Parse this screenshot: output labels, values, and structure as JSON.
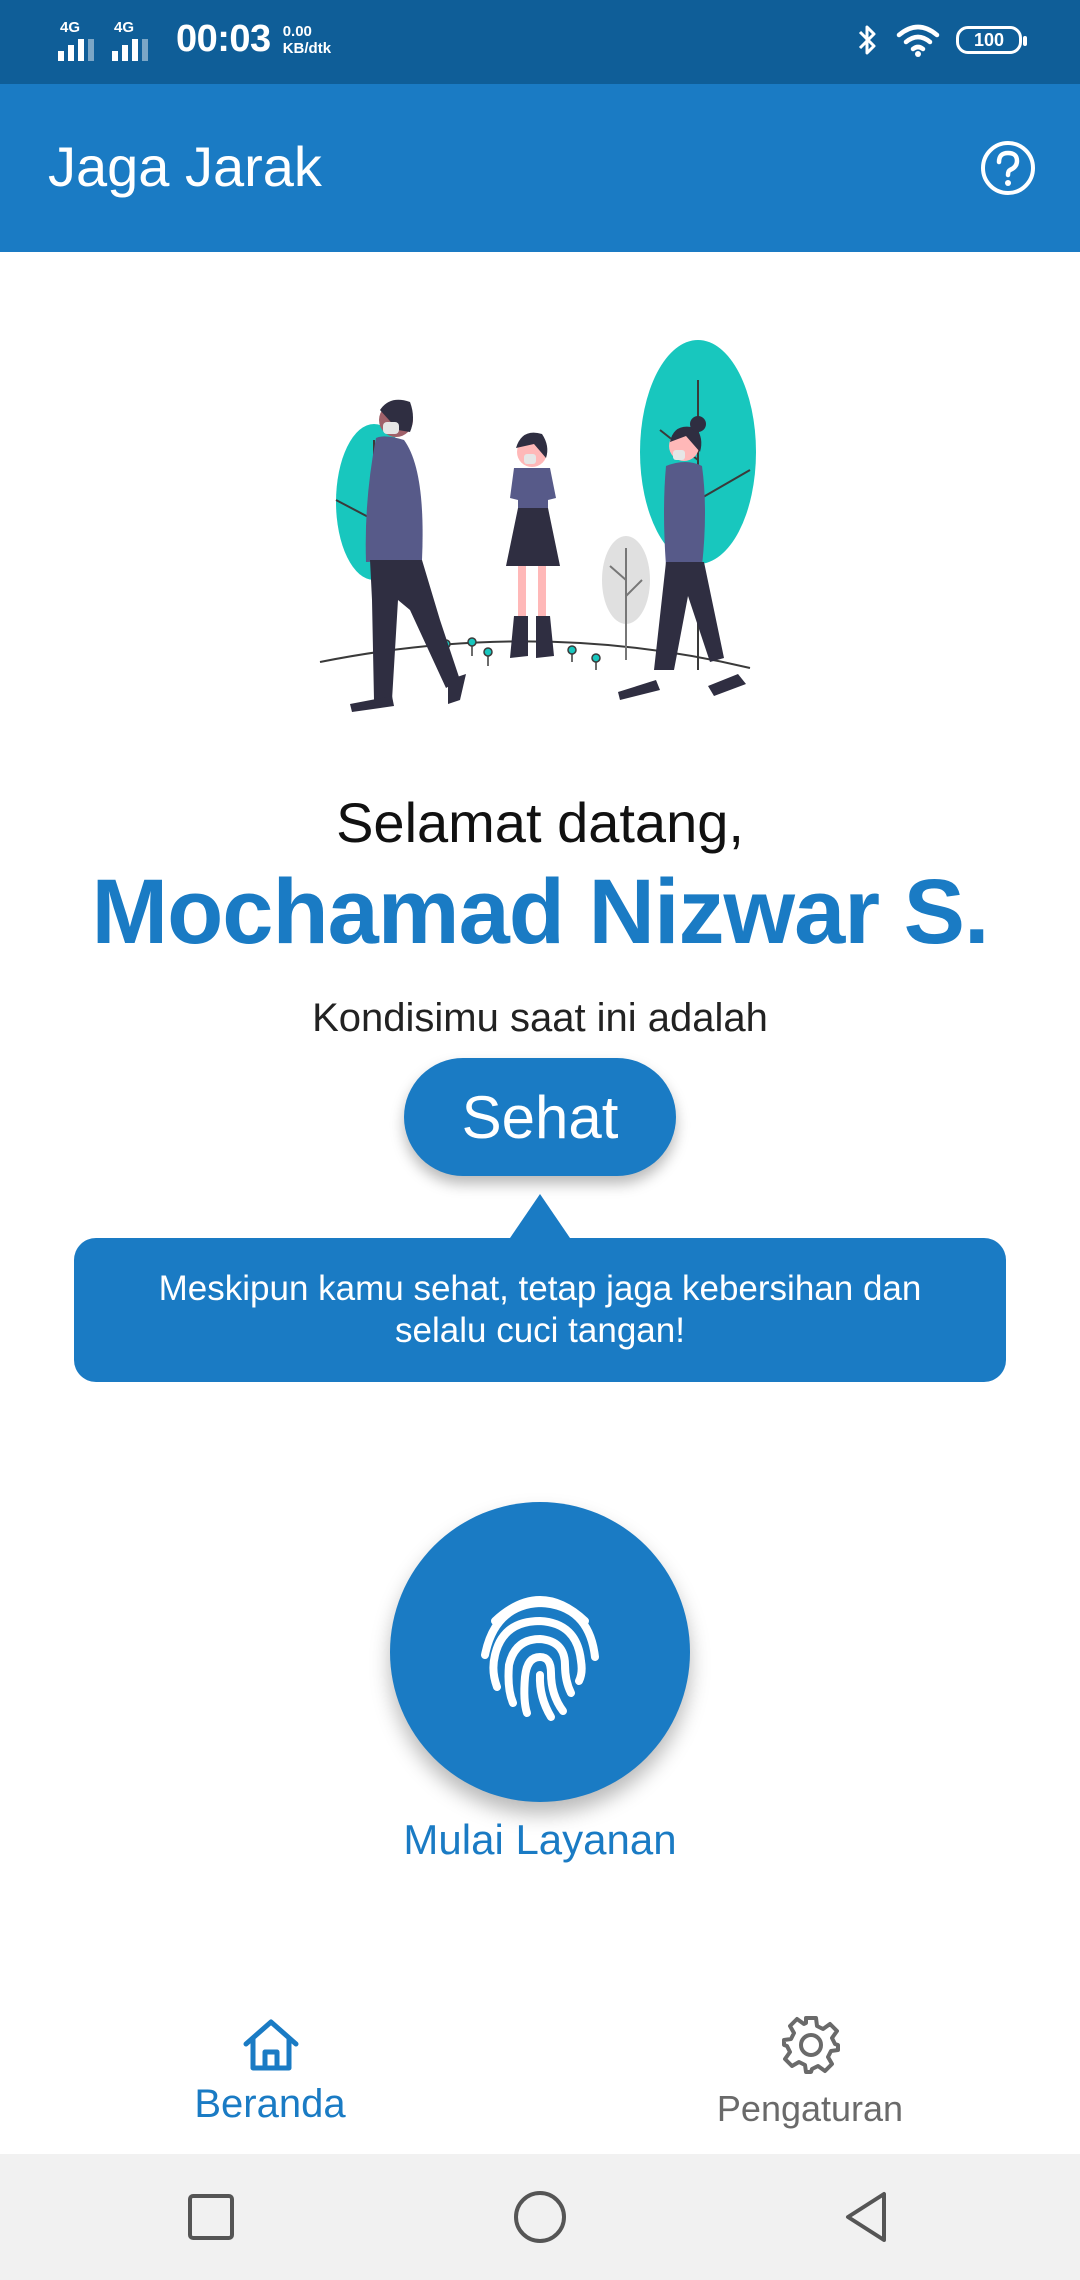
{
  "status_bar": {
    "network_1": "4G",
    "network_2": "4G",
    "time": "00:03",
    "speed_value": "0.00",
    "speed_unit": "KB/dtk",
    "battery": "100",
    "icons": [
      "bluetooth-icon",
      "wifi-icon",
      "battery-icon"
    ]
  },
  "app_bar": {
    "title": "Jaga Jarak",
    "help_icon": "help-circle-icon"
  },
  "main": {
    "welcome": "Selamat datang,",
    "user_name": "Mochamad Nizwar S.",
    "condition_label": "Kondisimu saat ini adalah",
    "condition_status": "Sehat",
    "tip": "Meskipun kamu sehat, tetap jaga kebersihan dan selalu cuci tangan!",
    "start_button_icon": "fingerprint-icon",
    "start_label": "Mulai Layanan"
  },
  "bottom_nav": {
    "items": [
      {
        "label": "Beranda",
        "icon": "home-icon",
        "active": true
      },
      {
        "label": "Pengaturan",
        "icon": "gear-icon",
        "active": false
      }
    ]
  },
  "system_nav": {
    "icons": [
      "recents-square-icon",
      "home-circle-icon",
      "back-triangle-icon"
    ]
  },
  "colors": {
    "primary": "#1a7bc4",
    "status_bar": "#0f5e98",
    "illustration_accent": "#18c7be",
    "figure_purple": "#575a89",
    "figure_dark": "#2f2e41"
  }
}
